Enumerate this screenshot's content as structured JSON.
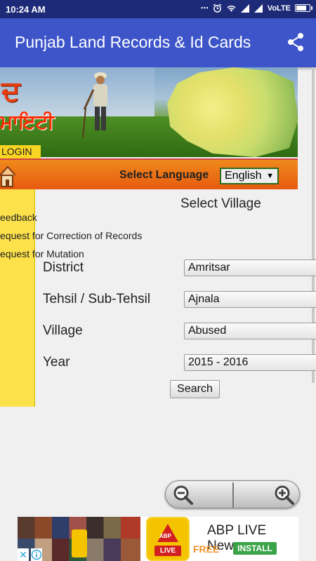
{
  "status_bar": {
    "time": "10:24 AM",
    "network": "VoLTE"
  },
  "app_bar": {
    "title": "Punjab Land Records & Id Cards",
    "share_icon": "share-icon"
  },
  "banner": {
    "logo_text_top": "ਦ",
    "logo_text_bottom": "ਮਾਇਟੀ",
    "login_label": "LOGIN"
  },
  "language_bar": {
    "label": "Select Language",
    "selected": "English"
  },
  "sidebar": {
    "items": [
      {
        "label": "eedback"
      },
      {
        "label": "equest for Correction of Records"
      },
      {
        "label": "equest for Mutation"
      }
    ]
  },
  "form": {
    "section_title": "Select Village",
    "fields": [
      {
        "label": "District",
        "value": "Amritsar"
      },
      {
        "label": "Tehsil / Sub-Tehsil",
        "value": "Ajnala"
      },
      {
        "label": "Village",
        "value": "Abused"
      },
      {
        "label": "Year",
        "value": "2015 - 2016"
      }
    ],
    "search_label": "Search"
  },
  "zoom": {
    "zoom_out_icon": "zoom-out-icon",
    "zoom_in_icon": "zoom-in-icon"
  },
  "ad": {
    "title": "ABP LIVE News",
    "free_label": "FREE",
    "install_label": "INSTALL",
    "logo_text": "ABP",
    "live_text": "LIVE",
    "close_glyph": "✕"
  },
  "colors": {
    "status_bar": "#1c2a78",
    "app_bar": "#3d55c9",
    "sidebar": "#fce14a",
    "language_bar": "#e65a10",
    "install_green": "#3aa348",
    "free_orange": "#f0932b"
  }
}
